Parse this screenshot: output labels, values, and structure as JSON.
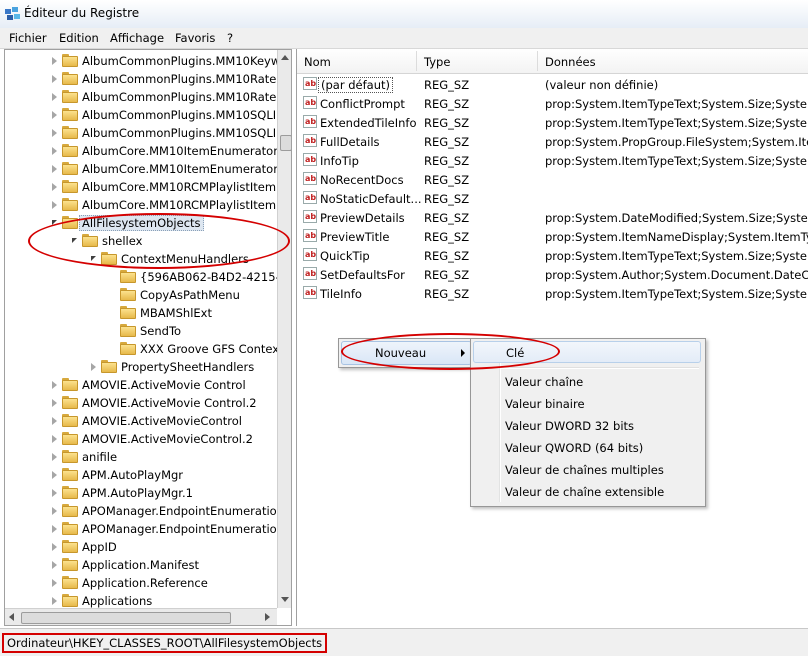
{
  "window": {
    "title": "Éditeur du Registre",
    "icon": "regedit-icon"
  },
  "menu": [
    "Fichier",
    "Edition",
    "Affichage",
    "Favoris",
    "?"
  ],
  "tree": [
    {
      "label": "AlbumCommonPlugins.MM10Keyw",
      "level": 1,
      "expander": "closed"
    },
    {
      "label": "AlbumCommonPlugins.MM10Rate",
      "level": 1,
      "expander": "closed"
    },
    {
      "label": "AlbumCommonPlugins.MM10Rate",
      "level": 1,
      "expander": "closed"
    },
    {
      "label": "AlbumCommonPlugins.MM10SQLI",
      "level": 1,
      "expander": "closed"
    },
    {
      "label": "AlbumCommonPlugins.MM10SQLI",
      "level": 1,
      "expander": "closed"
    },
    {
      "label": "AlbumCore.MM10ItemEnumerator",
      "level": 1,
      "expander": "closed"
    },
    {
      "label": "AlbumCore.MM10ItemEnumerator.",
      "level": 1,
      "expander": "closed"
    },
    {
      "label": "AlbumCore.MM10RCMPlaylistItem",
      "level": 1,
      "expander": "closed"
    },
    {
      "label": "AlbumCore.MM10RCMPlaylistItem",
      "level": 1,
      "expander": "closed"
    },
    {
      "label": "AllFilesystemObjects",
      "level": 1,
      "expander": "open",
      "selected": true
    },
    {
      "label": "shellex",
      "level": 2,
      "expander": "open"
    },
    {
      "label": "ContextMenuHandlers",
      "level": 3,
      "expander": "open"
    },
    {
      "label": "{596AB062-B4D2-4215-9F",
      "level": 4,
      "expander": "none"
    },
    {
      "label": "CopyAsPathMenu",
      "level": 4,
      "expander": "none"
    },
    {
      "label": "MBAMShlExt",
      "level": 4,
      "expander": "none"
    },
    {
      "label": "SendTo",
      "level": 4,
      "expander": "none"
    },
    {
      "label": "XXX Groove GFS Context",
      "level": 4,
      "expander": "none"
    },
    {
      "label": "PropertySheetHandlers",
      "level": 3,
      "expander": "closed"
    },
    {
      "label": "AMOVIE.ActiveMovie Control",
      "level": 1,
      "expander": "closed"
    },
    {
      "label": "AMOVIE.ActiveMovie Control.2",
      "level": 1,
      "expander": "closed"
    },
    {
      "label": "AMOVIE.ActiveMovieControl",
      "level": 1,
      "expander": "closed"
    },
    {
      "label": "AMOVIE.ActiveMovieControl.2",
      "level": 1,
      "expander": "closed"
    },
    {
      "label": "anifile",
      "level": 1,
      "expander": "closed"
    },
    {
      "label": "APM.AutoPlayMgr",
      "level": 1,
      "expander": "closed"
    },
    {
      "label": "APM.AutoPlayMgr.1",
      "level": 1,
      "expander": "closed"
    },
    {
      "label": "APOManager.EndpointEnumeration",
      "level": 1,
      "expander": "closed"
    },
    {
      "label": "APOManager.EndpointEnumeration",
      "level": 1,
      "expander": "closed"
    },
    {
      "label": "AppID",
      "level": 1,
      "expander": "closed"
    },
    {
      "label": "Application.Manifest",
      "level": 1,
      "expander": "closed"
    },
    {
      "label": "Application.Reference",
      "level": 1,
      "expander": "closed"
    },
    {
      "label": "Applications",
      "level": 1,
      "expander": "closed"
    }
  ],
  "list": {
    "columns": [
      "Nom",
      "Type",
      "Données"
    ],
    "rows": [
      {
        "name": "(par défaut)",
        "type": "REG_SZ",
        "data": "(valeur non définie)"
      },
      {
        "name": "ConflictPrompt",
        "type": "REG_SZ",
        "data": "prop:System.ItemTypeText;System.Size;System.Dat"
      },
      {
        "name": "ExtendedTileInfo",
        "type": "REG_SZ",
        "data": "prop:System.ItemTypeText;System.Size;System.Dat"
      },
      {
        "name": "FullDetails",
        "type": "REG_SZ",
        "data": "prop:System.PropGroup.FileSystem;System.ItemN"
      },
      {
        "name": "InfoTip",
        "type": "REG_SZ",
        "data": "prop:System.ItemTypeText;System.Size;System.Dat"
      },
      {
        "name": "NoRecentDocs",
        "type": "REG_SZ",
        "data": ""
      },
      {
        "name": "NoStaticDefault...",
        "type": "REG_SZ",
        "data": ""
      },
      {
        "name": "PreviewDetails",
        "type": "REG_SZ",
        "data": "prop:System.DateModified;System.Size;System.Dat"
      },
      {
        "name": "PreviewTitle",
        "type": "REG_SZ",
        "data": "prop:System.ItemNameDisplay;System.ItemTypeT"
      },
      {
        "name": "QuickTip",
        "type": "REG_SZ",
        "data": "prop:System.ItemTypeText;System.Size;System.Dat"
      },
      {
        "name": "SetDefaultsFor",
        "type": "REG_SZ",
        "data": "prop:System.Author;System.Document.DateCreate"
      },
      {
        "name": "TileInfo",
        "type": "REG_SZ",
        "data": "prop:System.ItemTypeText;System.Size;System.Dat"
      }
    ]
  },
  "context_menu": {
    "item": "Nouveau"
  },
  "submenu": {
    "first": "Clé",
    "items": [
      "Valeur chaîne",
      "Valeur binaire",
      "Valeur DWORD 32 bits",
      "Valeur QWORD (64 bits)",
      "Valeur de chaînes multiples",
      "Valeur de chaîne extensible"
    ]
  },
  "status": {
    "path": "Ordinateur\\HKEY_CLASSES_ROOT\\AllFilesystemObjects"
  },
  "colors": {
    "annotation": "#d40000",
    "selection": "#dde6f0",
    "menu_bg": "#f0f0f0"
  }
}
